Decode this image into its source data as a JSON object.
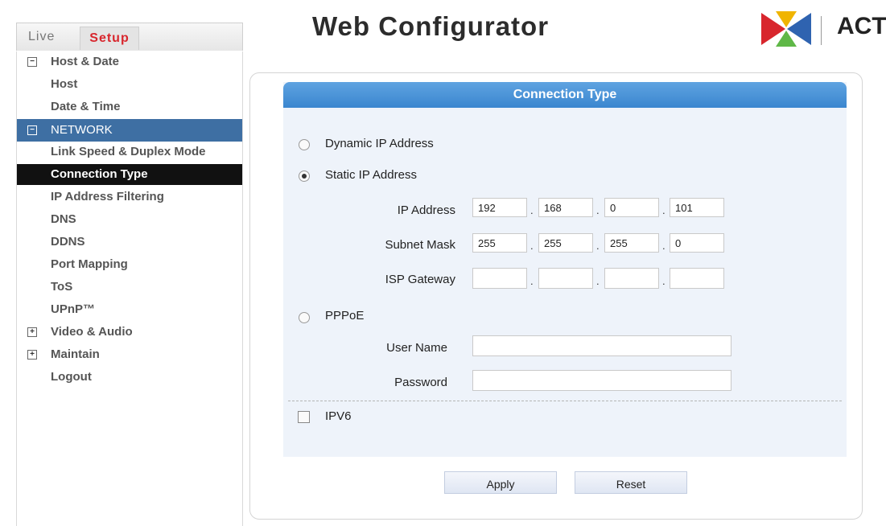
{
  "header": {
    "tab_live": "Live",
    "tab_setup": "Setup",
    "title": "Web Configurator",
    "brand": "ACT",
    "logo_icon": "act-logo-icon",
    "logo_colors": [
      "#d8262d",
      "#f0b400",
      "#5fb847",
      "#2f63b0"
    ]
  },
  "sidebar": {
    "items": [
      {
        "label": "Host & Date",
        "expander": "−"
      },
      {
        "label": "Host"
      },
      {
        "label": "Date & Time"
      },
      {
        "label": "NETWORK",
        "expander": "−"
      },
      {
        "label": "Link Speed & Duplex Mode"
      },
      {
        "label": "Connection Type"
      },
      {
        "label": "IP Address Filtering"
      },
      {
        "label": "DNS"
      },
      {
        "label": "DDNS"
      },
      {
        "label": "Port Mapping"
      },
      {
        "label": "ToS"
      },
      {
        "label": "UPnP™"
      },
      {
        "label": "Video & Audio",
        "expander": "+"
      },
      {
        "label": "Maintain",
        "expander": "+"
      },
      {
        "label": "Logout"
      }
    ]
  },
  "form": {
    "section_title": "Connection Type",
    "dynamic_label": "Dynamic IP Address",
    "static_label": "Static IP Address",
    "selected": "static",
    "ip_label": "IP Address",
    "ip_values": [
      "192",
      "168",
      "0",
      "101"
    ],
    "subnet_label": "Subnet Mask",
    "subnet_values": [
      "255",
      "255",
      "255",
      "0"
    ],
    "gateway_label": "ISP Gateway",
    "gateway_values": [
      "",
      "",
      "",
      ""
    ],
    "pppoe_label": "PPPoE",
    "username_label": "User Name",
    "username_value": "",
    "password_label": "Password",
    "password_value": "",
    "ipv6_label": "IPV6",
    "ipv6_checked": false,
    "dot": "."
  },
  "buttons": {
    "apply": "Apply",
    "reset": "Reset"
  }
}
